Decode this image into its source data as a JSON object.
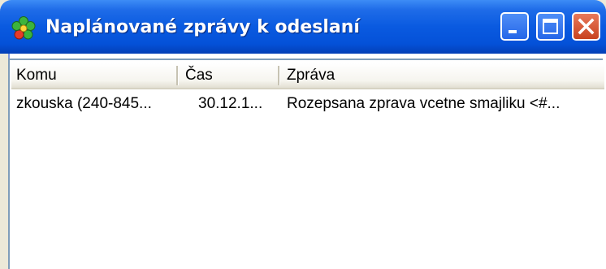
{
  "window": {
    "title": "Naplánované zprávy k odeslaní",
    "icon": "icq-flower-icon",
    "colors": {
      "titlebar": "#0a5ae0",
      "close": "#c8421e"
    }
  },
  "list": {
    "columns": [
      {
        "label": "Komu"
      },
      {
        "label": "Čas"
      },
      {
        "label": "Zpráva"
      }
    ],
    "rows": [
      {
        "komu": "zkouska (240-845...",
        "cas": "30.12.1...",
        "zprava": "Rozepsana zprava vcetne smajliku <#..."
      }
    ]
  }
}
